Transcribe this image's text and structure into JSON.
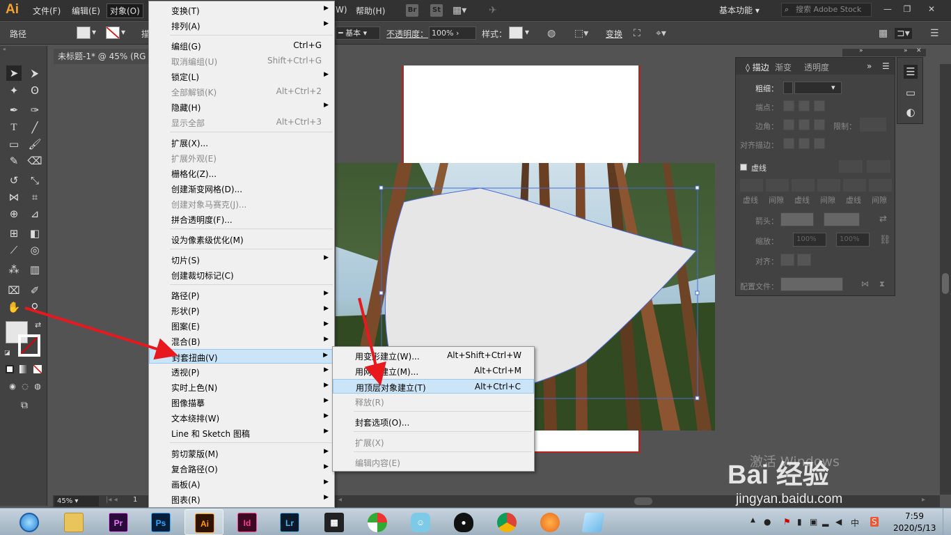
{
  "app": {
    "logo": "Ai",
    "menus": [
      "文件(F)",
      "编辑(E)",
      "对象(O)",
      "W)",
      "帮助(H)"
    ],
    "bridge": "Br",
    "stock": "St",
    "workspace": "基本功能",
    "search_placeholder": "搜索 Adobe Stock"
  },
  "control_bar": {
    "selection_label": "路径",
    "stroke_style": "基本",
    "opacity_label": "不透明度：",
    "opacity_value": "100%",
    "style_label": "样式：",
    "transform_label": "变换",
    "partial_label": "描"
  },
  "document": {
    "tab_title": "未标题-1* @ 45% (RG",
    "zoom": "45%",
    "page": "1"
  },
  "object_menu": {
    "items": [
      {
        "label": "变换(T)",
        "shortcut": "",
        "submenu": true,
        "disabled": false
      },
      {
        "label": "排列(A)",
        "shortcut": "",
        "submenu": true,
        "disabled": false
      },
      {
        "label": "编组(G)",
        "shortcut": "Ctrl+G",
        "submenu": false,
        "disabled": false
      },
      {
        "label": "取消编组(U)",
        "shortcut": "Shift+Ctrl+G",
        "submenu": false,
        "disabled": true
      },
      {
        "label": "锁定(L)",
        "shortcut": "",
        "submenu": true,
        "disabled": false
      },
      {
        "label": "全部解锁(K)",
        "shortcut": "Alt+Ctrl+2",
        "submenu": false,
        "disabled": true
      },
      {
        "label": "隐藏(H)",
        "shortcut": "",
        "submenu": true,
        "disabled": false
      },
      {
        "label": "显示全部",
        "shortcut": "Alt+Ctrl+3",
        "submenu": false,
        "disabled": true
      },
      {
        "label": "扩展(X)...",
        "shortcut": "",
        "submenu": false,
        "disabled": false
      },
      {
        "label": "扩展外观(E)",
        "shortcut": "",
        "submenu": false,
        "disabled": true
      },
      {
        "label": "栅格化(Z)...",
        "shortcut": "",
        "submenu": false,
        "disabled": false
      },
      {
        "label": "创建渐变网格(D)...",
        "shortcut": "",
        "submenu": false,
        "disabled": false
      },
      {
        "label": "创建对象马赛克(J)...",
        "shortcut": "",
        "submenu": false,
        "disabled": true
      },
      {
        "label": "拼合透明度(F)...",
        "shortcut": "",
        "submenu": false,
        "disabled": false
      },
      {
        "label": "设为像素级优化(M)",
        "shortcut": "",
        "submenu": false,
        "disabled": false
      },
      {
        "label": "切片(S)",
        "shortcut": "",
        "submenu": true,
        "disabled": false
      },
      {
        "label": "创建裁切标记(C)",
        "shortcut": "",
        "submenu": false,
        "disabled": false
      },
      {
        "label": "路径(P)",
        "shortcut": "",
        "submenu": true,
        "disabled": false
      },
      {
        "label": "形状(P)",
        "shortcut": "",
        "submenu": true,
        "disabled": false
      },
      {
        "label": "图案(E)",
        "shortcut": "",
        "submenu": true,
        "disabled": false
      },
      {
        "label": "混合(B)",
        "shortcut": "",
        "submenu": true,
        "disabled": false
      },
      {
        "label": "封套扭曲(V)",
        "shortcut": "",
        "submenu": true,
        "disabled": false
      },
      {
        "label": "透视(P)",
        "shortcut": "",
        "submenu": true,
        "disabled": false
      },
      {
        "label": "实时上色(N)",
        "shortcut": "",
        "submenu": true,
        "disabled": false
      },
      {
        "label": "图像描摹",
        "shortcut": "",
        "submenu": true,
        "disabled": false
      },
      {
        "label": "文本绕排(W)",
        "shortcut": "",
        "submenu": true,
        "disabled": false
      },
      {
        "label": "Line 和 Sketch 图稿",
        "shortcut": "",
        "submenu": true,
        "disabled": false
      },
      {
        "label": "剪切蒙版(M)",
        "shortcut": "",
        "submenu": true,
        "disabled": false
      },
      {
        "label": "复合路径(O)",
        "shortcut": "",
        "submenu": true,
        "disabled": false
      },
      {
        "label": "画板(A)",
        "shortcut": "",
        "submenu": true,
        "disabled": false
      },
      {
        "label": "图表(R)",
        "shortcut": "",
        "submenu": true,
        "disabled": false
      }
    ]
  },
  "envelope_submenu": {
    "items": [
      {
        "label": "用变形建立(W)...",
        "shortcut": "Alt+Shift+Ctrl+W",
        "disabled": false
      },
      {
        "label": "用网格建立(M)...",
        "shortcut": "Alt+Ctrl+M",
        "disabled": false
      },
      {
        "label": "用顶层对象建立(T)",
        "shortcut": "Alt+Ctrl+C",
        "disabled": false
      },
      {
        "label": "释放(R)",
        "shortcut": "",
        "disabled": true
      },
      {
        "label": "封套选项(O)...",
        "shortcut": "",
        "disabled": false
      },
      {
        "label": "扩展(X)",
        "shortcut": "",
        "disabled": true
      },
      {
        "label": "编辑内容(E)",
        "shortcut": "",
        "disabled": true
      }
    ]
  },
  "stroke_panel": {
    "tabs": [
      "描边",
      "渐变",
      "透明度"
    ],
    "weight_label": "粗细：",
    "cap_label": "端点：",
    "corner_label": "边角：",
    "limit_label": "限制：",
    "align_label": "对齐描边：",
    "dashed_label": "虚线",
    "dash_labels": [
      "虚线",
      "间隙",
      "虚线",
      "间隙",
      "虚线",
      "间隙"
    ],
    "arrowhead_label": "箭头：",
    "scale_label": "缩放：",
    "scale_values": [
      "100%",
      "100%"
    ],
    "align_label2": "对齐：",
    "profile_label": "配置文件："
  },
  "watermark": {
    "activate": "激活 Windows",
    "baidu": "Bai 经验",
    "site": "jingyan.baidu.com"
  },
  "taskbar": {
    "apps": [
      {
        "name": "Pr",
        "color": "#2a0a3a",
        "fg": "#e77cf7"
      },
      {
        "name": "Ps",
        "color": "#061e3a",
        "fg": "#31a8ff"
      },
      {
        "name": "Ai",
        "color": "#2e1300",
        "fg": "#ff9a00"
      },
      {
        "name": "Id",
        "color": "#3d0822",
        "fg": "#ff3f94"
      },
      {
        "name": "Lr",
        "color": "#0a1a2a",
        "fg": "#4eb6f0"
      }
    ],
    "ime": "中",
    "time": "7:59",
    "date": "2020/5/13"
  },
  "colors": {
    "menu_highlight": "#cce4f7",
    "arrow": "#e8191e",
    "accent": "#f7a232"
  }
}
